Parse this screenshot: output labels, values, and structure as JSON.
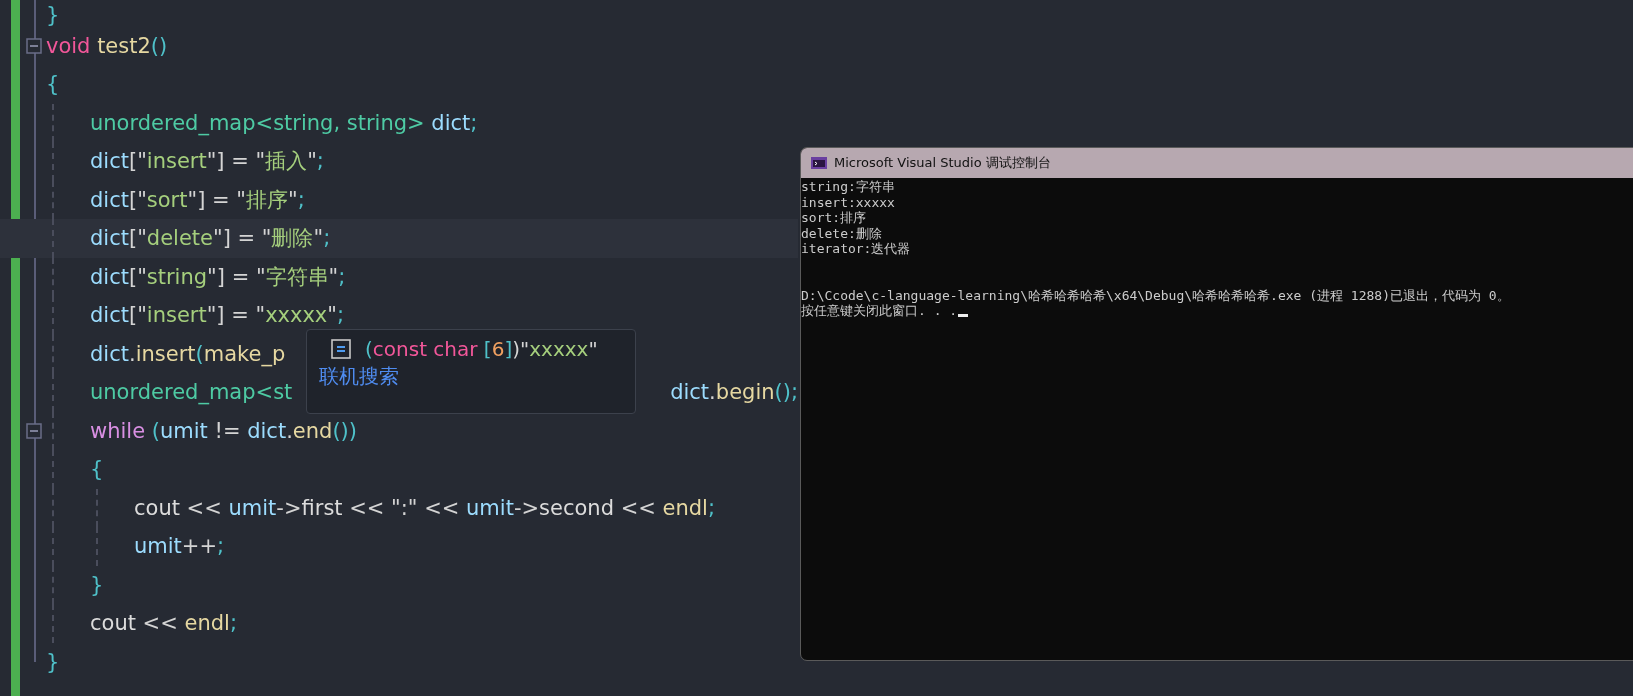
{
  "editor": {
    "lines": [
      {
        "fold_marker": false,
        "highlighted": false,
        "tokens": [
          {
            "kind": "paren",
            "t": "}"
          }
        ]
      },
      {
        "fold_marker": true,
        "highlighted": false,
        "tokens": [
          {
            "kind": "keyword",
            "t": "void "
          },
          {
            "kind": "function",
            "t": "test2"
          },
          {
            "kind": "paren",
            "t": "()"
          }
        ]
      },
      {
        "fold_marker": false,
        "highlighted": false,
        "tokens": [
          {
            "kind": "paren",
            "t": "{"
          }
        ],
        "children": [
          {
            "fold_marker": false,
            "highlighted": false,
            "tokens": [
              {
                "kind": "type",
                "t": "unordered_map<string, string> "
              },
              {
                "kind": "variable",
                "t": "dict"
              },
              {
                "kind": "punct",
                "t": ";"
              }
            ]
          },
          {
            "fold_marker": false,
            "highlighted": false,
            "tokens": [
              {
                "kind": "variable",
                "t": "dict"
              },
              {
                "kind": "operator",
                "t": "[\""
              },
              {
                "kind": "string",
                "t": "insert"
              },
              {
                "kind": "operator",
                "t": "\"] = \""
              },
              {
                "kind": "string",
                "t": "插入"
              },
              {
                "kind": "operator",
                "t": "\""
              },
              {
                "kind": "punct",
                "t": ";"
              }
            ]
          },
          {
            "fold_marker": false,
            "highlighted": false,
            "tokens": [
              {
                "kind": "variable",
                "t": "dict"
              },
              {
                "kind": "operator",
                "t": "[\""
              },
              {
                "kind": "string",
                "t": "sort"
              },
              {
                "kind": "operator",
                "t": "\"] = \""
              },
              {
                "kind": "string",
                "t": "排序"
              },
              {
                "kind": "operator",
                "t": "\""
              },
              {
                "kind": "punct",
                "t": ";"
              }
            ]
          },
          {
            "fold_marker": false,
            "highlighted": true,
            "tokens": [
              {
                "kind": "variable",
                "t": "dict"
              },
              {
                "kind": "operator",
                "t": "[\""
              },
              {
                "kind": "string",
                "t": "delete"
              },
              {
                "kind": "operator",
                "t": "\"] = \""
              },
              {
                "kind": "string",
                "t": "删除"
              },
              {
                "kind": "operator",
                "t": "\""
              },
              {
                "kind": "punct",
                "t": ";"
              }
            ]
          },
          {
            "fold_marker": false,
            "highlighted": false,
            "tokens": [
              {
                "kind": "variable",
                "t": "dict"
              },
              {
                "kind": "operator",
                "t": "[\""
              },
              {
                "kind": "string",
                "t": "string"
              },
              {
                "kind": "operator",
                "t": "\"] = \""
              },
              {
                "kind": "string",
                "t": "字符串"
              },
              {
                "kind": "operator",
                "t": "\""
              },
              {
                "kind": "punct",
                "t": ";"
              }
            ]
          },
          {
            "fold_marker": false,
            "highlighted": false,
            "tokens": [
              {
                "kind": "variable",
                "t": "dict"
              },
              {
                "kind": "operator",
                "t": "[\""
              },
              {
                "kind": "string",
                "t": "insert"
              },
              {
                "kind": "operator",
                "t": "\"] = \""
              },
              {
                "kind": "string",
                "t": "xxxxx"
              },
              {
                "kind": "operator",
                "t": "\""
              },
              {
                "kind": "punct",
                "t": ";"
              }
            ]
          },
          {
            "fold_marker": false,
            "highlighted": false,
            "tokens": [
              {
                "kind": "variable",
                "t": "dict"
              },
              {
                "kind": "operator",
                "t": "."
              },
              {
                "kind": "function",
                "t": "insert"
              },
              {
                "kind": "paren",
                "t": "("
              },
              {
                "kind": "function",
                "t": "make_p"
              }
            ]
          },
          {
            "fold_marker": false,
            "highlighted": false,
            "tokens": [
              {
                "kind": "type",
                "t": "unordered_map<st"
              }
            ],
            "tail": [
              {
                "kind": "variable",
                "t": "dict"
              },
              {
                "kind": "operator",
                "t": "."
              },
              {
                "kind": "function",
                "t": "begin"
              },
              {
                "kind": "paren",
                "t": "()"
              },
              {
                "kind": "punct",
                "t": ";"
              }
            ]
          },
          {
            "fold_marker": true,
            "highlighted": false,
            "tokens": [
              {
                "kind": "control",
                "t": "while "
              },
              {
                "kind": "paren",
                "t": "("
              },
              {
                "kind": "variable",
                "t": "umit"
              },
              {
                "kind": "operator",
                "t": " != "
              },
              {
                "kind": "variable",
                "t": "dict"
              },
              {
                "kind": "operator",
                "t": "."
              },
              {
                "kind": "function",
                "t": "end"
              },
              {
                "kind": "paren",
                "t": "())"
              }
            ]
          },
          {
            "fold_marker": false,
            "highlighted": false,
            "tokens": [
              {
                "kind": "paren",
                "t": "{"
              }
            ],
            "children": [
              {
                "fold_marker": false,
                "highlighted": false,
                "tokens": [
                  {
                    "kind": "plain",
                    "t": "cout"
                  },
                  {
                    "kind": "operator",
                    "t": " << "
                  },
                  {
                    "kind": "variable",
                    "t": "umit"
                  },
                  {
                    "kind": "operator",
                    "t": "->"
                  },
                  {
                    "kind": "plain",
                    "t": "first"
                  },
                  {
                    "kind": "operator",
                    "t": " << \":\" << "
                  },
                  {
                    "kind": "variable",
                    "t": "umit"
                  },
                  {
                    "kind": "operator",
                    "t": "->"
                  },
                  {
                    "kind": "plain",
                    "t": "second"
                  },
                  {
                    "kind": "operator",
                    "t": " << "
                  },
                  {
                    "kind": "function",
                    "t": "endl"
                  },
                  {
                    "kind": "punct",
                    "t": ";"
                  }
                ]
              },
              {
                "fold_marker": false,
                "highlighted": false,
                "tokens": [
                  {
                    "kind": "variable",
                    "t": "umit"
                  },
                  {
                    "kind": "operator",
                    "t": "++"
                  },
                  {
                    "kind": "punct",
                    "t": ";"
                  }
                ]
              }
            ]
          },
          {
            "fold_marker": false,
            "highlighted": false,
            "tokens": [
              {
                "kind": "paren",
                "t": "}"
              }
            ]
          },
          {
            "fold_marker": false,
            "highlighted": false,
            "tokens": [
              {
                "kind": "plain",
                "t": "cout"
              },
              {
                "kind": "operator",
                "t": " << "
              },
              {
                "kind": "function",
                "t": "endl"
              },
              {
                "kind": "punct",
                "t": ";"
              }
            ]
          }
        ]
      },
      {
        "fold_marker": false,
        "highlighted": false,
        "tokens": [
          {
            "kind": "paren",
            "t": "}"
          }
        ]
      }
    ]
  },
  "tooltip": {
    "signature": [
      {
        "kind": "paren",
        "t": "("
      },
      {
        "kind": "keyword",
        "t": "const char "
      },
      {
        "kind": "paren",
        "t": "["
      },
      {
        "kind": "number",
        "t": "6"
      },
      {
        "kind": "paren",
        "t": "]"
      },
      {
        "kind": "operator",
        "t": ")\""
      },
      {
        "kind": "string",
        "t": "xxxxx"
      },
      {
        "kind": "operator",
        "t": "\""
      }
    ],
    "link": "联机搜索"
  },
  "console": {
    "title": "Microsoft Visual Studio 调试控制台",
    "output": [
      "string:字符串",
      "insert:xxxxx",
      "sort:排序",
      "delete:删除",
      "iterator:迭代器"
    ],
    "exit_lines": [
      "D:\\Ccode\\c-language-learning\\哈希哈希哈希\\x64\\Debug\\哈希哈希哈希.exe (进程 1288)已退出，代码为 0。",
      "按任意键关闭此窗口. . ."
    ]
  }
}
